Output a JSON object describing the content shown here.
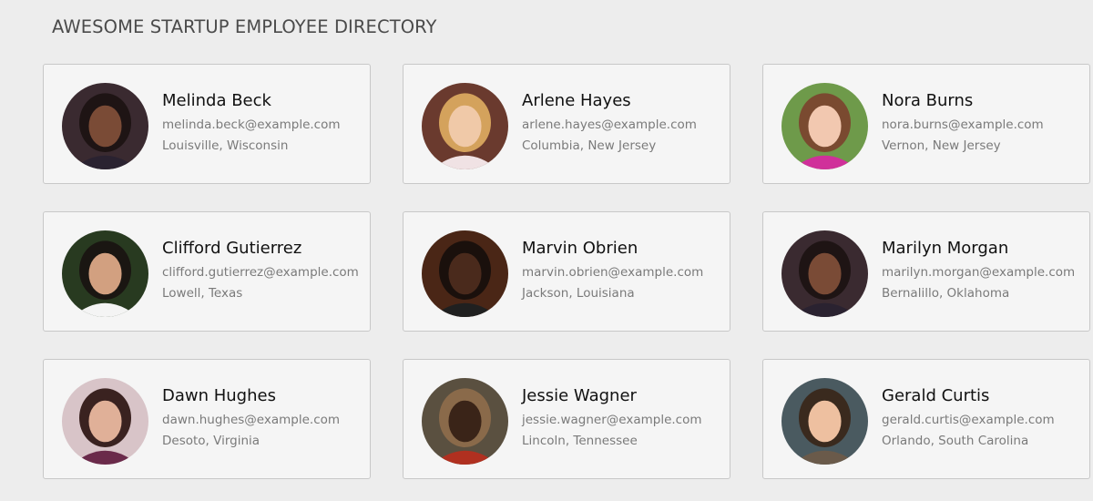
{
  "header": {
    "title": "AWESOME STARTUP EMPLOYEE DIRECTORY"
  },
  "employees": [
    {
      "name": "Melinda Beck",
      "email": "melinda.beck@example.com",
      "location": "Louisville, Wisconsin",
      "photo": {
        "bg": "#3a2a30",
        "hair": "#1e1414",
        "skin": "#7a4b36",
        "shirt": "#2a2230"
      }
    },
    {
      "name": "Arlene Hayes",
      "email": "arlene.hayes@example.com",
      "location": "Columbia, New Jersey",
      "photo": {
        "bg": "#6a3a2e",
        "hair": "#d4a25c",
        "skin": "#f0c9a8",
        "shirt": "#f0e2e4"
      }
    },
    {
      "name": "Nora Burns",
      "email": "nora.burns@example.com",
      "location": "Vernon, New Jersey",
      "photo": {
        "bg": "#6e9a4a",
        "hair": "#7a4a30",
        "skin": "#f2c8b0",
        "shirt": "#d0309a"
      }
    },
    {
      "name": "Clifford Gutierrez",
      "email": "clifford.gutierrez@example.com",
      "location": "Lowell, Texas",
      "photo": {
        "bg": "#283a20",
        "hair": "#1a1612",
        "skin": "#d2a080",
        "shirt": "#f4f4f4"
      }
    },
    {
      "name": "Marvin Obrien",
      "email": "marvin.obrien@example.com",
      "location": "Jackson, Louisiana",
      "photo": {
        "bg": "#4a2616",
        "hair": "#1a100c",
        "skin": "#4a2a1c",
        "shirt": "#202020"
      }
    },
    {
      "name": "Marilyn Morgan",
      "email": "marilyn.morgan@example.com",
      "location": "Bernalillo, Oklahoma",
      "photo": {
        "bg": "#3a2a30",
        "hair": "#1e1414",
        "skin": "#7a4b36",
        "shirt": "#2a2230"
      }
    },
    {
      "name": "Dawn Hughes",
      "email": "dawn.hughes@example.com",
      "location": "Desoto, Virginia",
      "photo": {
        "bg": "#d8c4c8",
        "hair": "#3a2220",
        "skin": "#e0b098",
        "shirt": "#6a2a4a"
      }
    },
    {
      "name": "Jessie Wagner",
      "email": "jessie.wagner@example.com",
      "location": "Lincoln, Tennessee",
      "photo": {
        "bg": "#5a5040",
        "hair": "#8a6a4a",
        "skin": "#3a2418",
        "shirt": "#b03020"
      }
    },
    {
      "name": "Gerald Curtis",
      "email": "gerald.curtis@example.com",
      "location": "Orlando, South Carolina",
      "photo": {
        "bg": "#4a5a60",
        "hair": "#3a2a1e",
        "skin": "#eec0a0",
        "shirt": "#6a5a4a"
      }
    }
  ]
}
